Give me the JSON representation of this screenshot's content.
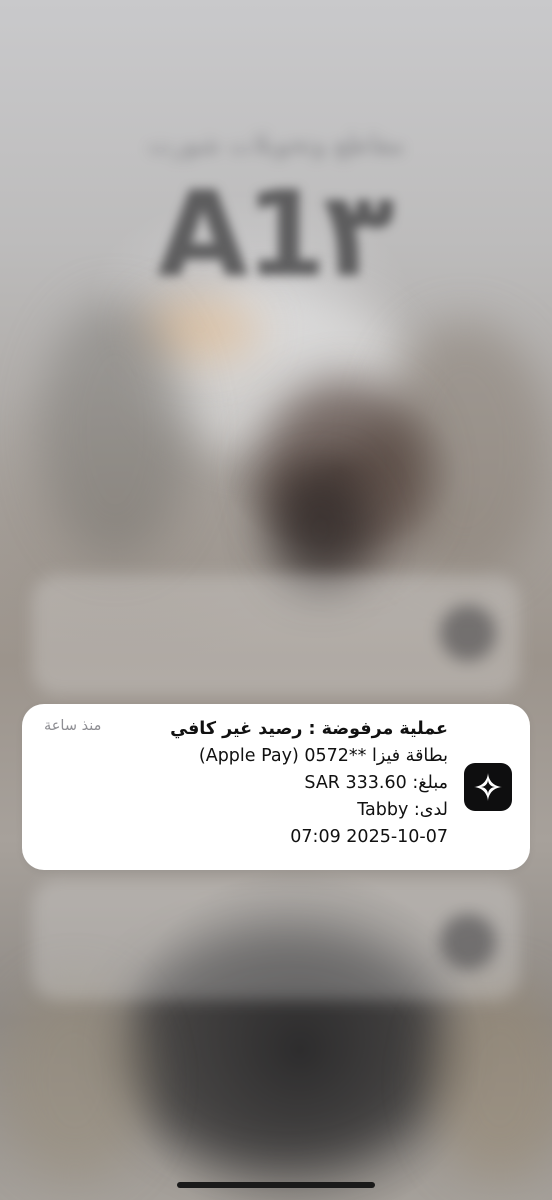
{
  "notification": {
    "app_icon": "sparkle-icon",
    "title": "عملية مرفوضة : رصيد غير كافي",
    "time": "منذ ساعة",
    "lines": [
      "بطاقة فيزا **0572 (Apple Pay)",
      "مبلغ: SAR 333.60",
      "لدى: Tabby",
      "2025-10-07 07:09"
    ]
  },
  "wallpaper": {
    "headline": "مقاطع وتحويلات شورت",
    "logo_text": "A1۳"
  }
}
